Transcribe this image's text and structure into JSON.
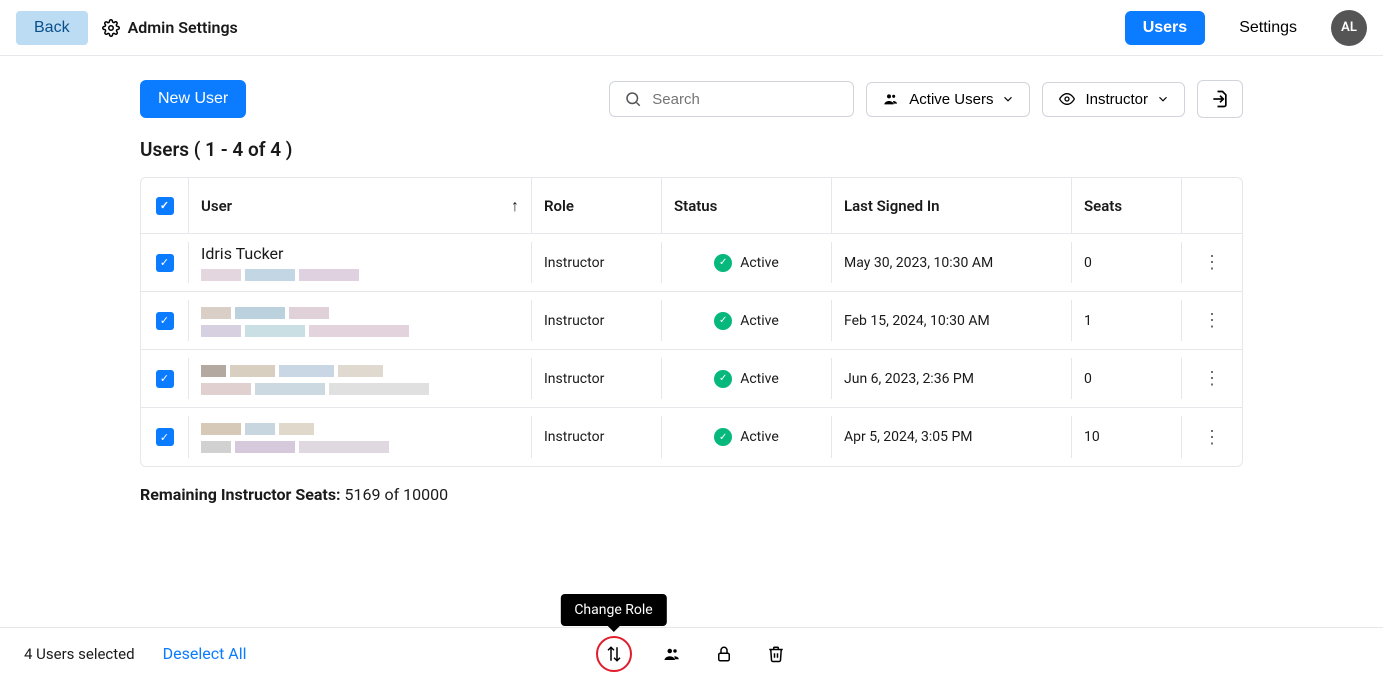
{
  "topbar": {
    "back_label": "Back",
    "title": "Admin Settings",
    "tabs": {
      "users": "Users",
      "settings": "Settings"
    },
    "avatar_initials": "AL"
  },
  "toolbar": {
    "new_user_label": "New User",
    "search_placeholder": "Search",
    "filter_status_label": "Active Users",
    "filter_role_label": "Instructor"
  },
  "count_heading": "Users ( 1 - 4 of 4 )",
  "columns": {
    "user": "User",
    "role": "Role",
    "status": "Status",
    "last_signed_in": "Last Signed In",
    "seats": "Seats"
  },
  "rows": [
    {
      "name": "Idris Tucker",
      "role": "Instructor",
      "status": "Active",
      "last_signed_in": "May 30, 2023, 10:30 AM",
      "seats": "0"
    },
    {
      "name": "",
      "role": "Instructor",
      "status": "Active",
      "last_signed_in": "Feb 15, 2024, 10:30 AM",
      "seats": "1"
    },
    {
      "name": "",
      "role": "Instructor",
      "status": "Active",
      "last_signed_in": "Jun 6, 2023, 2:36 PM",
      "seats": "0"
    },
    {
      "name": "",
      "role": "Instructor",
      "status": "Active",
      "last_signed_in": "Apr 5, 2024, 3:05 PM",
      "seats": "10"
    }
  ],
  "remaining": {
    "label": "Remaining Instructor Seats:",
    "value": "5169 of 10000"
  },
  "bottombar": {
    "selected_text": "4  Users selected",
    "deselect_label": "Deselect All",
    "tooltip_change_role": "Change Role"
  }
}
